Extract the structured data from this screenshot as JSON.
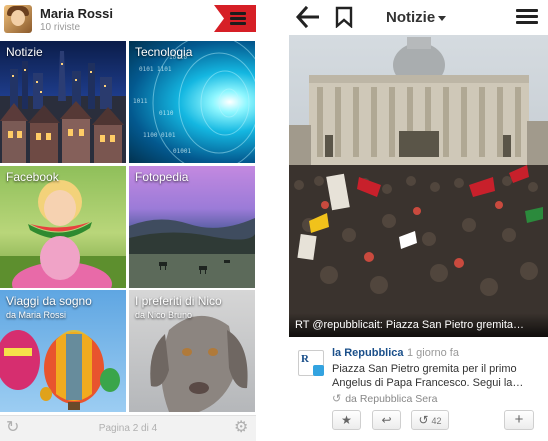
{
  "left_panel": {
    "user": {
      "name": "Maria Rossi",
      "subtitle": "10 riviste"
    },
    "tiles": [
      {
        "title": "Notizie",
        "subtitle": ""
      },
      {
        "title": "Tecnologia",
        "subtitle": ""
      },
      {
        "title": "Facebook",
        "subtitle": ""
      },
      {
        "title": "Fotopedia",
        "subtitle": ""
      },
      {
        "title": "Viaggi da sogno",
        "subtitle": "da Maria Rossi"
      },
      {
        "title": "I preferiti di Nico",
        "subtitle": "da Nico Bruno"
      }
    ],
    "footer": {
      "page_label": "Pagina 2 di 4",
      "refresh_icon": "refresh-icon",
      "settings_icon": "gear-icon"
    },
    "accent_color": "#d61f26"
  },
  "right_panel": {
    "topbar": {
      "section_title": "Notizie",
      "back_icon": "back-arrow-icon",
      "bookmark_icon": "bookmark-icon",
      "menu_icon": "hamburger-icon"
    },
    "photo_caption": "RT @repubblicait: Piazza San Pietro gremita…",
    "post": {
      "source_name": "la Repubblica",
      "time": "1 giorno fa",
      "text": "Piazza San Pietro gremita per il primo Angelus di Papa Francesco. Segui la…",
      "via": "da Repubblica Sera"
    },
    "actions": {
      "retweet_count": "42"
    }
  }
}
